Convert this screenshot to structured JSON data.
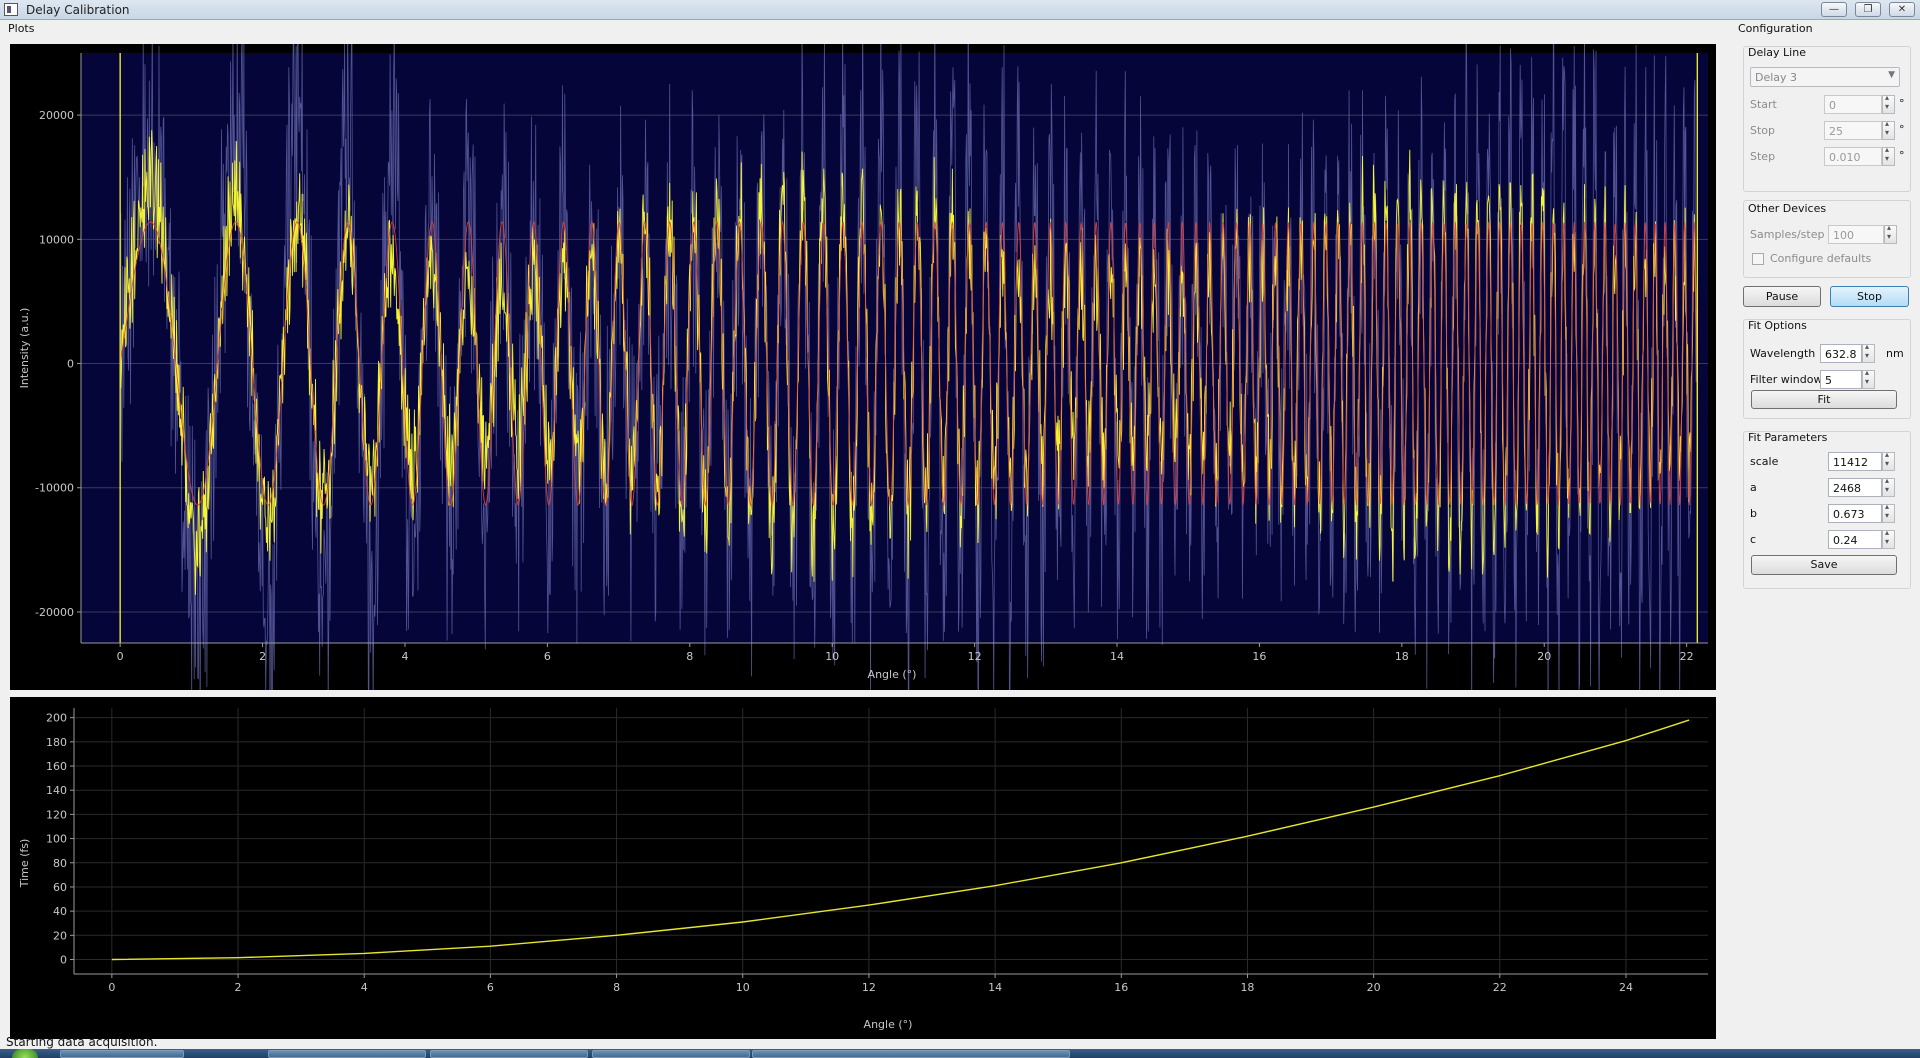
{
  "window": {
    "title": "Delay Calibration",
    "minimize": "—",
    "restore": "❐",
    "close": "✕"
  },
  "plots": {
    "group_label": "Plots",
    "intensity": {
      "ylabel": "Intensity (a.u.)",
      "xlabel": "Angle (°)",
      "yticks": [
        "20000",
        "10000",
        "0",
        "-10000",
        "-20000"
      ],
      "xticks": [
        "0",
        "2",
        "4",
        "6",
        "8",
        "10",
        "12",
        "14",
        "16",
        "18",
        "20",
        "22"
      ]
    },
    "time": {
      "ylabel": "Time (fs)",
      "xlabel": "Angle (°)",
      "yticks": [
        "200",
        "180",
        "160",
        "140",
        "120",
        "100",
        "80",
        "60",
        "40",
        "20",
        "0"
      ],
      "xticks": [
        "0",
        "2",
        "4",
        "6",
        "8",
        "10",
        "12",
        "14",
        "16",
        "18",
        "20",
        "22",
        "24"
      ]
    }
  },
  "chart_data": [
    {
      "type": "line",
      "xlabel": "Angle (°)",
      "ylabel": "Intensity (a.u.)",
      "xlim": [
        -0.55,
        22.3
      ],
      "ylim": [
        -22500,
        25000
      ],
      "marker_lines_x": [
        0,
        22.15
      ],
      "grid": true,
      "series": [
        {
          "color": "#5f61a3",
          "amplitude": 19500,
          "noise": 0.45
        },
        {
          "color": "#ffff33",
          "amplitude": 14000,
          "noise": 0.25
        },
        {
          "color": "#e1413a",
          "amplitude": 11400,
          "noise": 0
        }
      ]
    },
    {
      "type": "line",
      "xlabel": "Angle (°)",
      "ylabel": "Time (fs)",
      "xlim": [
        -0.6,
        25.3
      ],
      "ylim": [
        -12,
        208
      ],
      "grid": true,
      "series": [
        {
          "color": "#e6e62e",
          "x": [
            0,
            2,
            4,
            6,
            8,
            10,
            12,
            14,
            16,
            18,
            20,
            22,
            24,
            25
          ],
          "y": [
            0,
            1.5,
            5,
            11,
            20,
            31,
            45,
            61,
            80,
            102,
            126,
            152,
            181,
            198
          ]
        }
      ]
    }
  ],
  "config": {
    "group_label": "Configuration",
    "delay_line": {
      "title": "Delay Line",
      "device": "Delay 3",
      "start_label": "Start",
      "start_value": "0",
      "stop_label": "Stop",
      "stop_value": "25",
      "step_label": "Step",
      "step_value": "0.010",
      "unit": "°"
    },
    "other_devices": {
      "title": "Other Devices",
      "samples_label": "Samples/step",
      "samples_value": "100",
      "defaults_label": "Configure defaults"
    },
    "pause_label": "Pause",
    "stop_label": "Stop",
    "fit_options": {
      "title": "Fit Options",
      "wavelength_label": "Wavelength",
      "wavelength_value": "632.8",
      "wavelength_unit": "nm",
      "filter_label": "Filter window",
      "filter_value": "5",
      "fit_label": "Fit"
    },
    "fit_parameters": {
      "title": "Fit Parameters",
      "scale_label": "scale",
      "scale_value": "11412",
      "a_label": "a",
      "a_value": "2468",
      "b_label": "b",
      "b_value": "0.673",
      "c_label": "c",
      "c_value": "0.24",
      "save_label": "Save"
    }
  },
  "status": {
    "message": "Starting data acquisition."
  }
}
